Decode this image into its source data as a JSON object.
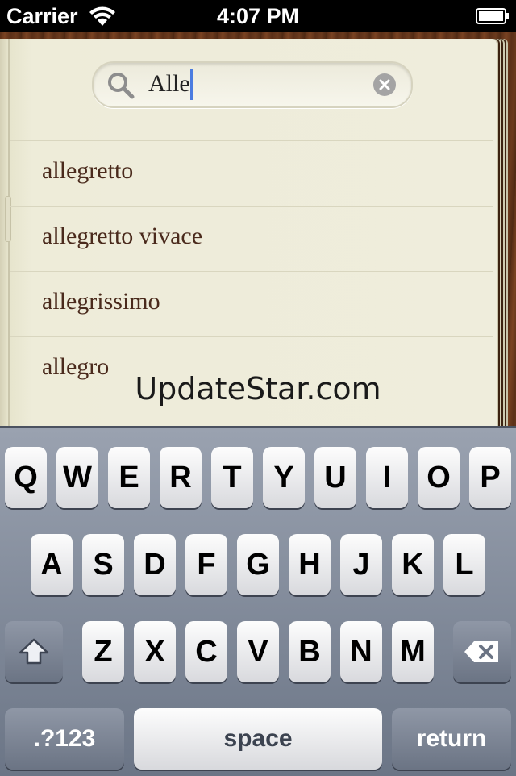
{
  "status_bar": {
    "carrier": "Carrier",
    "time": "4:07 PM"
  },
  "search": {
    "query": "Alle"
  },
  "results": [
    "allegretto",
    "allegretto vivace",
    "allegrissimo",
    "allegro"
  ],
  "watermark": "UpdateStar.com",
  "keyboard": {
    "row1": [
      "Q",
      "W",
      "E",
      "R",
      "T",
      "Y",
      "U",
      "I",
      "O",
      "P"
    ],
    "row2": [
      "A",
      "S",
      "D",
      "F",
      "G",
      "H",
      "J",
      "K",
      "L"
    ],
    "row3": [
      "Z",
      "X",
      "C",
      "V",
      "B",
      "N",
      "M"
    ],
    "numbers_label": ".?123",
    "space_label": "space",
    "return_label": "return",
    "shift_icon": "shift-icon",
    "delete_icon": "delete-icon"
  }
}
